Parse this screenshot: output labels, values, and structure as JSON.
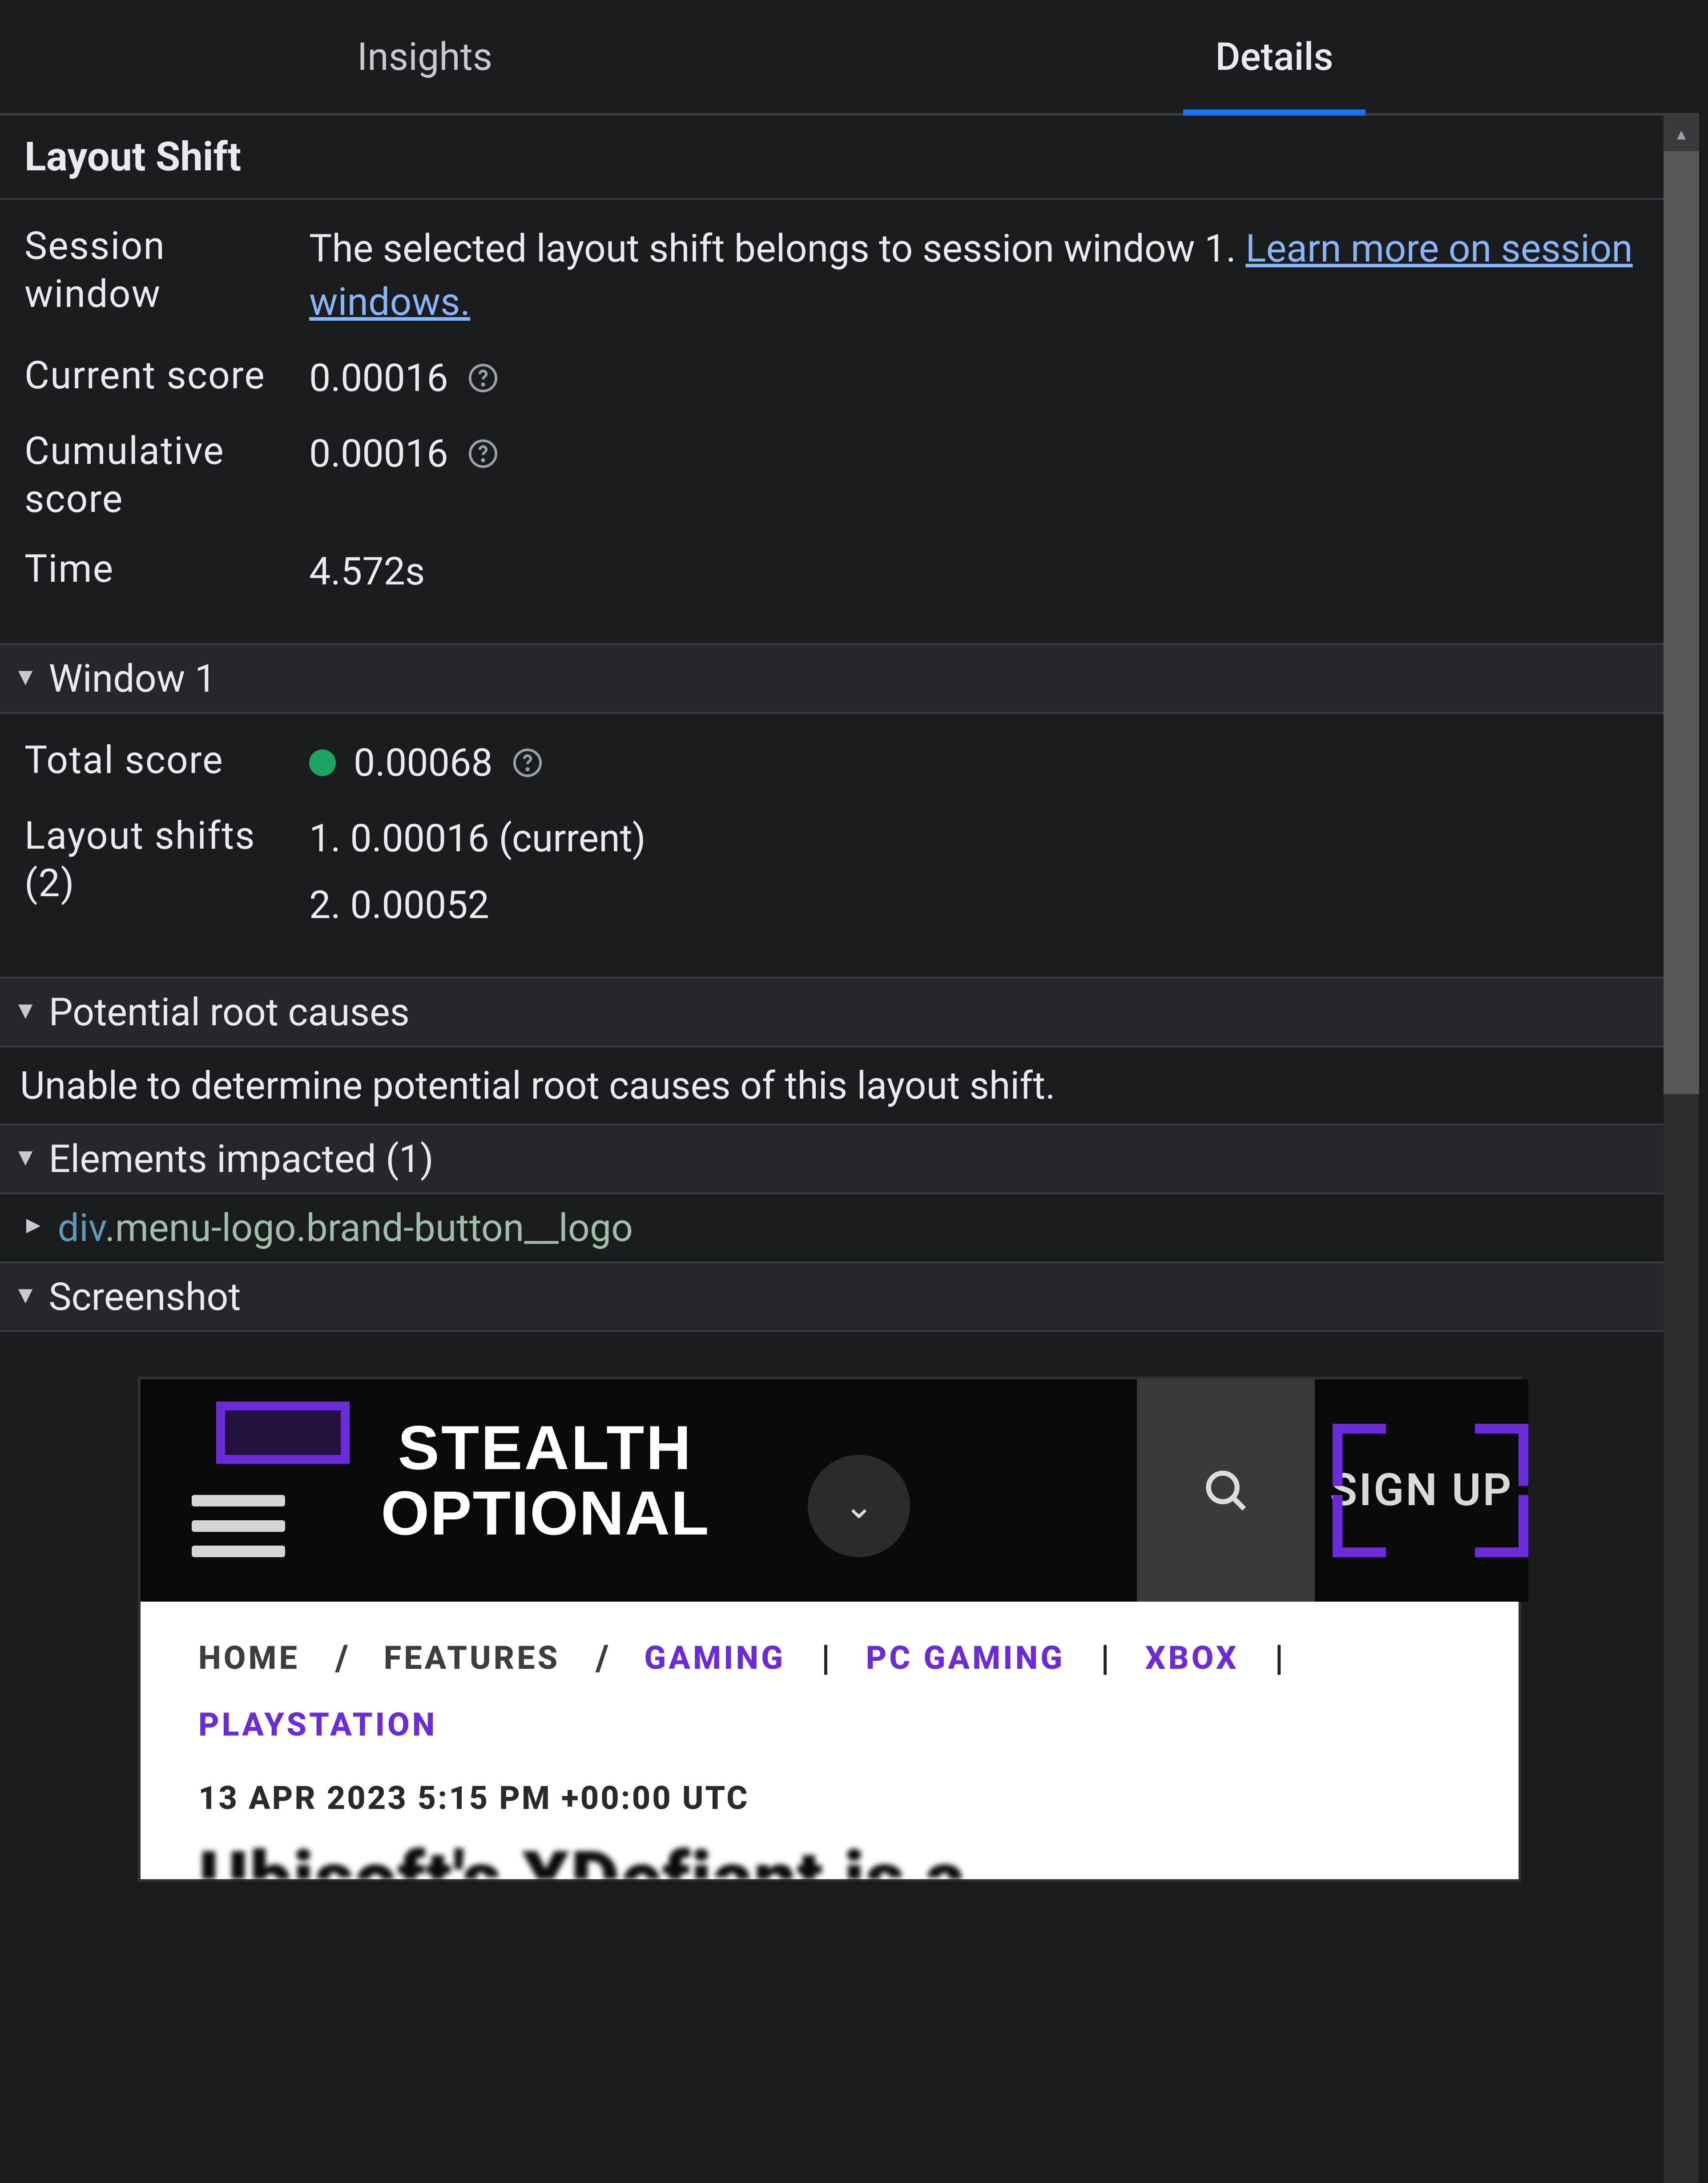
{
  "tabs": {
    "insights": "Insights",
    "details": "Details"
  },
  "header": {
    "title": "Layout Shift"
  },
  "summary": {
    "session_window_key": "Session window",
    "session_window_prefix": "The selected layout shift belongs to session window 1. ",
    "session_window_link": "Learn more on session windows.",
    "current_score_key": "Current score",
    "current_score_val": "0.00016",
    "cumulative_score_key": "Cumulative score",
    "cumulative_score_val": "0.00016",
    "time_key": "Time",
    "time_val": "4.572s"
  },
  "window": {
    "title": "Window 1",
    "total_score_key": "Total score",
    "total_score_val": "0.00068",
    "shifts_key": "Layout shifts (2)",
    "shifts": [
      "1. 0.00016 (current)",
      "2. 0.00052"
    ]
  },
  "root_causes": {
    "title": "Potential root causes",
    "body": "Unable to determine potential root causes of this layout shift."
  },
  "elements": {
    "title": "Elements impacted (1)",
    "item_tag": "div",
    "item_cls": ".menu-logo.brand-button__logo"
  },
  "screenshot": {
    "title": "Screenshot",
    "logo_l1": "STEALTH",
    "logo_l2": "OPTIONAL",
    "signup": "SIGN UP",
    "crumbs": {
      "home": "HOME",
      "features": "FEATURES",
      "gaming": "GAMING",
      "pc": "PC GAMING",
      "xbox": "XBOX",
      "ps": "PLAYSTATION"
    },
    "timestamp": "13 APR 2023 5:15 PM +00:00 UTC",
    "headline": "Ubisoft's XDefiant is a"
  }
}
